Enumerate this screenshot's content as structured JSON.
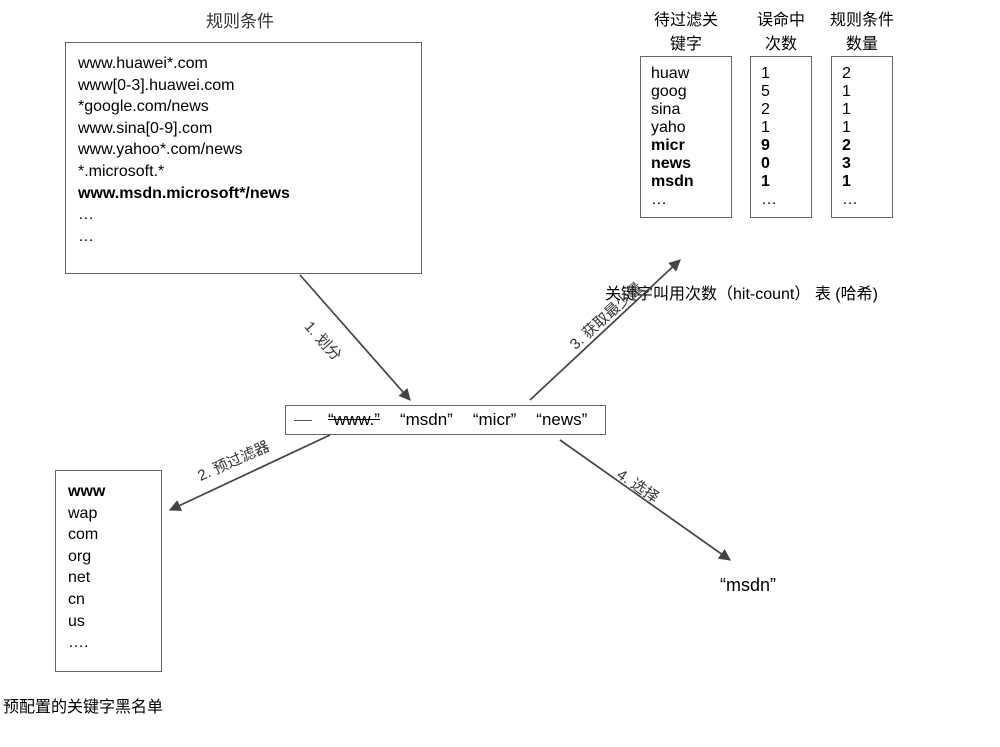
{
  "labels": {
    "rules_title": "规则条件",
    "blacklist_caption": "预配置的关键字黑名单",
    "table_caption": "关键字叫用次数（hit-count） 表 (哈希)",
    "col_keyword": "待过滤关\n键字",
    "col_misshits": "误命中\n次数",
    "col_rulecount": "规则条件\n数量",
    "edge1": "1. 划分",
    "edge2": "2. 预过滤器",
    "edge3": "3. 获取最少量",
    "edge4": "4. 选择",
    "result": "“msdn”"
  },
  "rules": [
    {
      "text": "www.huawei*.com",
      "bold": false
    },
    {
      "text": "www[0-3].huawei.com",
      "bold": false
    },
    {
      "text": "*google.com/news",
      "bold": false
    },
    {
      "text": "www.sina[0-9].com",
      "bold": false
    },
    {
      "text": "www.yahoo*.com/news",
      "bold": false
    },
    {
      "text": "*.microsoft.*",
      "bold": false
    },
    {
      "text": "www.msdn.microsoft*/news",
      "bold": true
    },
    {
      "text": "…",
      "bold": false
    },
    {
      "text": "…",
      "bold": false
    }
  ],
  "tokens": [
    {
      "text": "“www.”",
      "strike": true
    },
    {
      "text": "“msdn”",
      "strike": false
    },
    {
      "text": "“micr”",
      "strike": false
    },
    {
      "text": "“news”",
      "strike": false
    }
  ],
  "blacklist": [
    {
      "text": "www",
      "bold": true
    },
    {
      "text": "wap",
      "bold": false
    },
    {
      "text": "com",
      "bold": false
    },
    {
      "text": "org",
      "bold": false
    },
    {
      "text": "net",
      "bold": false
    },
    {
      "text": "cn",
      "bold": false
    },
    {
      "text": "us",
      "bold": false
    },
    {
      "text": "….",
      "bold": false
    }
  ],
  "hit_table": {
    "rows": [
      {
        "keyword": "huaw",
        "miss": "1",
        "rules": "2",
        "bold": false
      },
      {
        "keyword": "goog",
        "miss": "5",
        "rules": "1",
        "bold": false
      },
      {
        "keyword": "sina",
        "miss": "2",
        "rules": "1",
        "bold": false
      },
      {
        "keyword": "yaho",
        "miss": "1",
        "rules": "1",
        "bold": false
      },
      {
        "keyword": "micr",
        "miss": "9",
        "rules": "2",
        "bold": true
      },
      {
        "keyword": "news",
        "miss": "0",
        "rules": "3",
        "bold": true
      },
      {
        "keyword": "msdn",
        "miss": "1",
        "rules": "1",
        "bold": true
      },
      {
        "keyword": "…",
        "miss": "…",
        "rules": "…",
        "bold": false
      }
    ]
  }
}
